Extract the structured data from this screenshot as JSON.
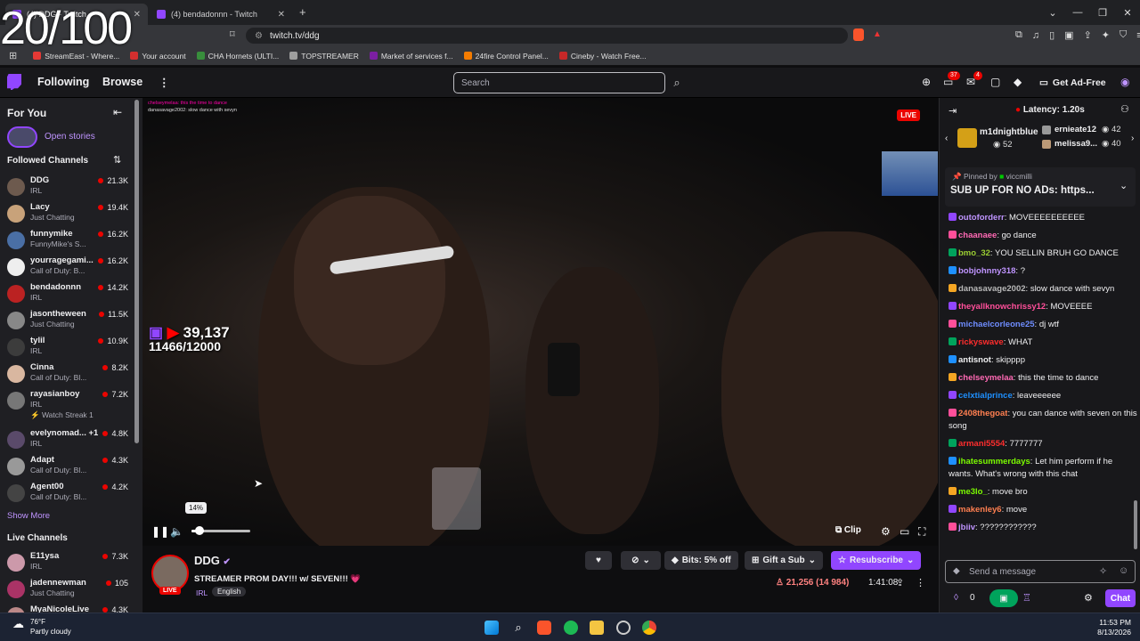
{
  "overlay_counter": "20/100",
  "browser": {
    "tabs": [
      {
        "title": "(4) DDG - Twitch"
      },
      {
        "title": "(4) bendadonnn - Twitch"
      }
    ],
    "url": "twitch.tv/ddg",
    "bookmarks": [
      {
        "label": "StreamEast - Where...",
        "color": "#e53935"
      },
      {
        "label": "Your account",
        "color": "#d32f2f"
      },
      {
        "label": "CHA Hornets (ULTI...",
        "color": "#388e3c"
      },
      {
        "label": "TOPSTREAMER",
        "color": "#9e9e9e"
      },
      {
        "label": "Market of services f...",
        "color": "#7b1fa2"
      },
      {
        "label": "24fire Control Panel...",
        "color": "#f57c00"
      },
      {
        "label": "Cineby - Watch Free...",
        "color": "#c62828"
      }
    ]
  },
  "nav": {
    "following": "Following",
    "browse": "Browse",
    "search_placeholder": "Search",
    "badge_notifications": "37",
    "badge_inbox": "4",
    "ad_free": "Get Ad-Free"
  },
  "sidebar": {
    "for_you": "For You",
    "open_stories": "Open stories",
    "followed_title": "Followed Channels",
    "followed": [
      {
        "name": "DDG",
        "category": "IRL",
        "viewers": "21.3K"
      },
      {
        "name": "Lacy",
        "category": "Just Chatting",
        "viewers": "19.4K"
      },
      {
        "name": "funnymike",
        "category": "FunnyMike's S...",
        "viewers": "16.2K"
      },
      {
        "name": "yourragegami...",
        "category": "Call of Duty: B...",
        "viewers": "16.2K"
      },
      {
        "name": "bendadonnn",
        "category": "IRL",
        "viewers": "14.2K"
      },
      {
        "name": "jasontheween",
        "category": "Just Chatting",
        "viewers": "11.5K"
      },
      {
        "name": "tylil",
        "category": "IRL",
        "viewers": "10.9K"
      },
      {
        "name": "Cinna",
        "category": "Call of Duty: Bl...",
        "viewers": "8.2K"
      },
      {
        "name": "rayasianboy",
        "category": "IRL",
        "viewers": "7.2K",
        "extra": "Watch Streak 1"
      },
      {
        "name": "evelynomad... +1",
        "category": "IRL",
        "viewers": "4.8K"
      },
      {
        "name": "Adapt",
        "category": "Call of Duty: Bl...",
        "viewers": "4.3K"
      },
      {
        "name": "Agent00",
        "category": "Call of Duty: Bl...",
        "viewers": "4.2K"
      }
    ],
    "show_more": "Show More",
    "live_title": "Live Channels",
    "live": [
      {
        "name": "E11ysa",
        "category": "IRL",
        "viewers": "7.3K"
      },
      {
        "name": "jadennewman",
        "category": "Just Chatting",
        "viewers": "105"
      },
      {
        "name": "MyaNicoleLive",
        "category": "",
        "viewers": "4.3K"
      }
    ]
  },
  "video": {
    "live_label": "LIVE",
    "overlay_count": "39,137",
    "overlay_goal": "11466/12000",
    "volume_tip": "14%",
    "volume_level": 0.14,
    "clip": "Clip"
  },
  "stream": {
    "channel": "DDG",
    "title": "STREAMER PROM DAY!!! w/ SEVEN!!! 💗",
    "category": "IRL",
    "language": "English",
    "live": "LIVE",
    "bits": "Bits: 5% off",
    "gift": "Gift a Sub",
    "resubscribe": "Resubscribe",
    "viewers": "21,256 (14 984)",
    "uptime": "1:41:08"
  },
  "chat": {
    "latency": "Latency: 1.20s",
    "hype_top": {
      "name": "m1dnightblue",
      "count": "52"
    },
    "hype_others": [
      {
        "name": "ernieate12",
        "count": "42"
      },
      {
        "name": "melissa9...",
        "count": "40"
      }
    ],
    "pinned_by": "Pinned by",
    "pinned_user": "viccmilli",
    "pinned_text": "SUB UP FOR NO ADs: https...",
    "messages": [
      {
        "user": "outoforderr",
        "color": "#bf94ff",
        "text": "MOVEEEEEEEEEE"
      },
      {
        "user": "chaanaee",
        "color": "#ff69b4",
        "text": "go dance"
      },
      {
        "user": "bmo_32",
        "color": "#9acd32",
        "text": "YOU SELLIN BRUH GO DANCE"
      },
      {
        "user": "bobjohnny318",
        "color": "#bf94ff",
        "text": "?"
      },
      {
        "user": "danasavage2002",
        "color": "#b8b8b8",
        "text": "slow dance with sevyn"
      },
      {
        "user": "theyallknowchrissy12",
        "color": "#ff4f9a",
        "text": "MOVEEEE"
      },
      {
        "user": "michaelcorleone25",
        "color": "#6f8dff",
        "text": "dj wtf"
      },
      {
        "user": "rickyswave",
        "color": "#ff2d2d",
        "text": "WHAT"
      },
      {
        "user": "antisnot",
        "color": "#efeff1",
        "text": "skipppp"
      },
      {
        "user": "chelseymelaa",
        "color": "#ff69b4",
        "text": "this the time to dance"
      },
      {
        "user": "celxtialprince",
        "color": "#1e90ff",
        "text": "leaveeeeee"
      },
      {
        "user": "2408thegoat",
        "color": "#ff7f50",
        "text": "you can dance with seven on this song"
      },
      {
        "user": "armani5554",
        "color": "#ff2d2d",
        "text": "7777777"
      },
      {
        "user": "ihatesummerdays",
        "color": "#7cfc00",
        "text": "Let him perform if he wants. What's wrong with this chat"
      },
      {
        "user": "me3lo_",
        "color": "#7cfc00",
        "text": "move bro"
      },
      {
        "user": "makenley6",
        "color": "#ff7f50",
        "text": "move"
      },
      {
        "user": "jbiiv",
        "color": "#bf94ff",
        "text": "????????????"
      }
    ],
    "send_placeholder": "Send a message",
    "points": "0",
    "chat_button": "Chat"
  },
  "taskbar": {
    "temp": "76°F",
    "weather": "Partly cloudy",
    "time": "11:53 PM",
    "date": "8/13/2026"
  }
}
